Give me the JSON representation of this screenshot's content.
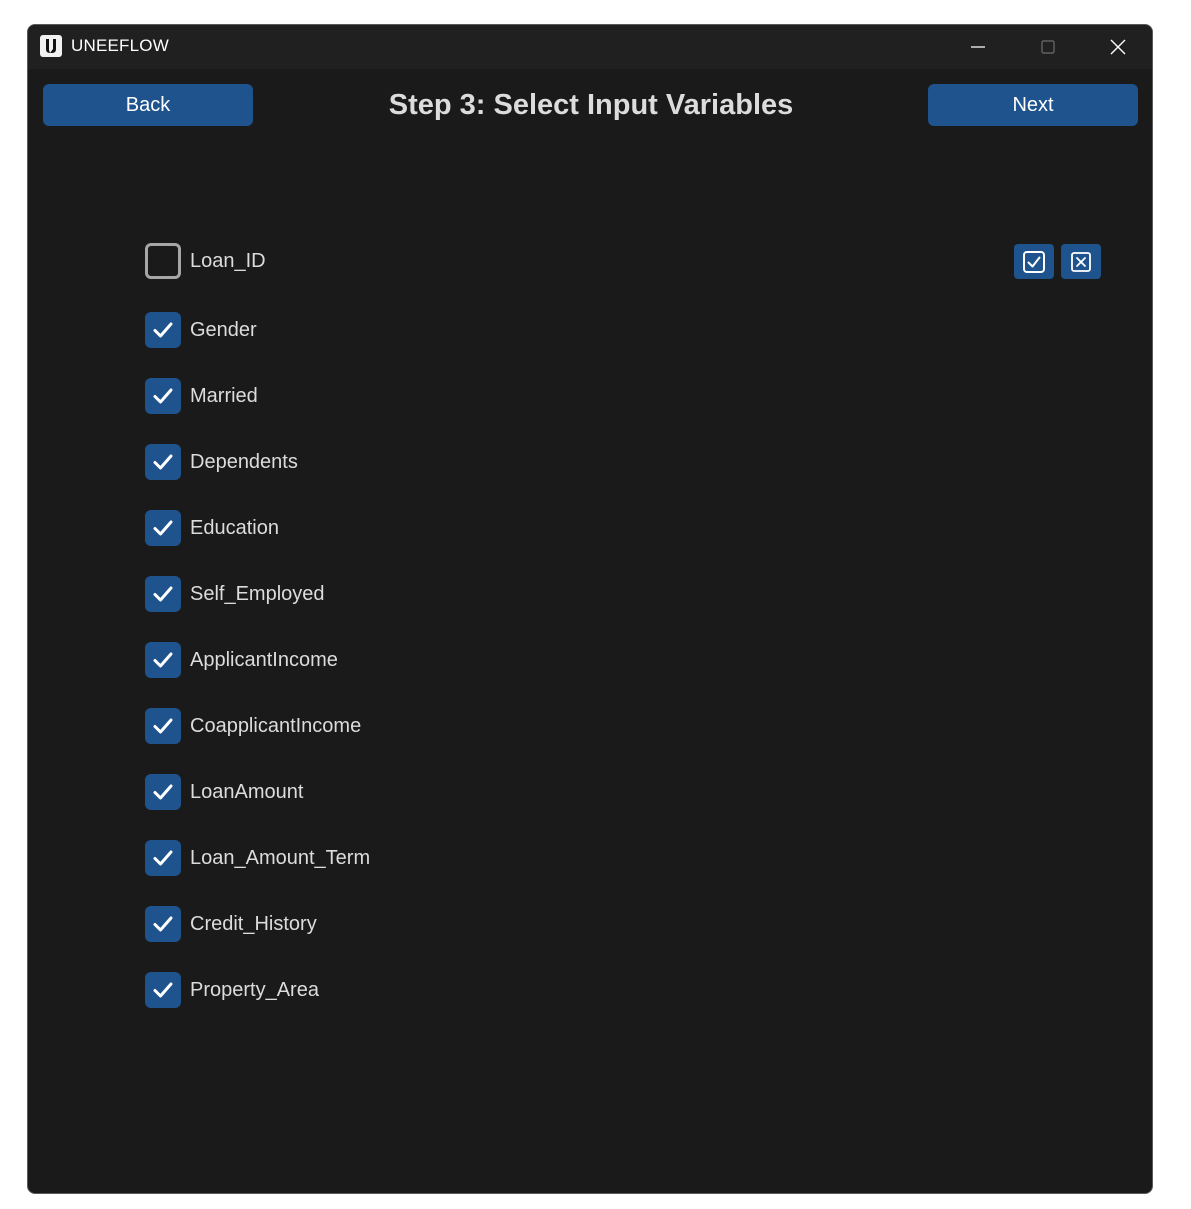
{
  "window": {
    "title": "UNEEFLOW"
  },
  "header": {
    "back_label": "Back",
    "title": "Step 3: Select Input Variables",
    "next_label": "Next"
  },
  "variables": [
    {
      "label": "Loan_ID",
      "checked": false
    },
    {
      "label": "Gender",
      "checked": true
    },
    {
      "label": "Married",
      "checked": true
    },
    {
      "label": "Dependents",
      "checked": true
    },
    {
      "label": "Education",
      "checked": true
    },
    {
      "label": "Self_Employed",
      "checked": true
    },
    {
      "label": "ApplicantIncome",
      "checked": true
    },
    {
      "label": "CoapplicantIncome",
      "checked": true
    },
    {
      "label": "LoanAmount",
      "checked": true
    },
    {
      "label": "Loan_Amount_Term",
      "checked": true
    },
    {
      "label": "Credit_History",
      "checked": true
    },
    {
      "label": "Property_Area",
      "checked": true
    }
  ],
  "toolbar": {
    "select_all_icon": "checkbox-checked-icon",
    "deselect_all_icon": "checkbox-x-icon"
  },
  "colors": {
    "accent": "#1f538d",
    "background": "#1a1a1a",
    "titlebar": "#202020",
    "text": "#dcdcdc",
    "unchecked_border": "#a6a6a6"
  }
}
